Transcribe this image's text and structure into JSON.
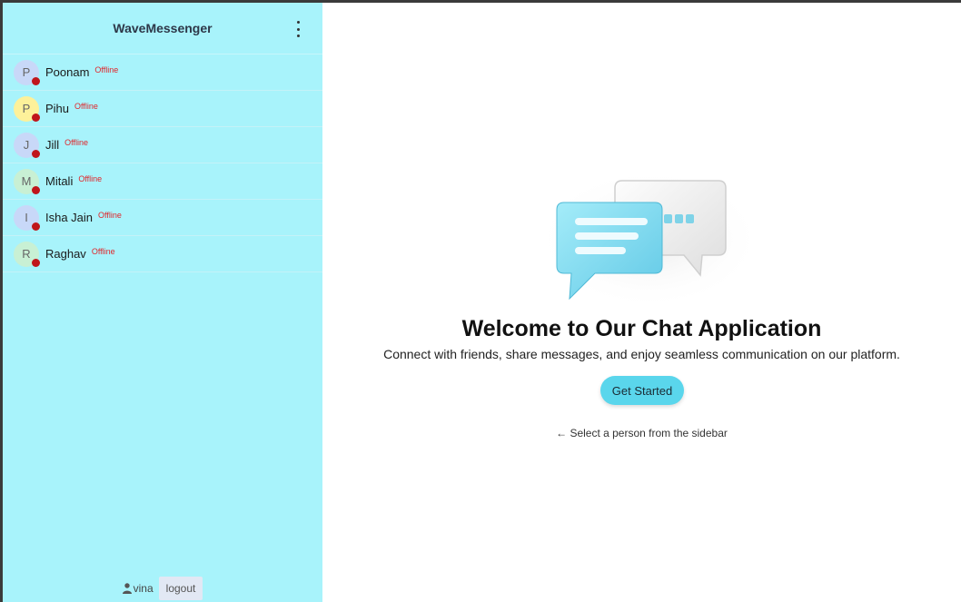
{
  "sidebar": {
    "title": "WaveMessenger",
    "contacts": [
      {
        "initial": "P",
        "name": "Poonam",
        "status": "Offline",
        "avatar_color": "#c8d8f8"
      },
      {
        "initial": "P",
        "name": "Pihu",
        "status": "Offline",
        "avatar_color": "#fdf19a"
      },
      {
        "initial": "J",
        "name": "Jill",
        "status": "Offline",
        "avatar_color": "#c8d8f8"
      },
      {
        "initial": "M",
        "name": "Mitali",
        "status": "Offline",
        "avatar_color": "#c8f0d4"
      },
      {
        "initial": "I",
        "name": "Isha Jain",
        "status": "Offline",
        "avatar_color": "#c8d8f8"
      },
      {
        "initial": "R",
        "name": "Raghav",
        "status": "Offline",
        "avatar_color": "#c8f0d4"
      }
    ],
    "footer": {
      "username": "vina",
      "logout_label": "logout"
    }
  },
  "main": {
    "title": "Welcome to Our Chat Application",
    "subtitle": "Connect with friends, share messages, and enjoy seamless communication on our platform.",
    "cta_label": "Get Started",
    "hint": "← Select a person from the sidebar"
  },
  "icons": {
    "menu": "kebab-menu-icon",
    "user": "user-icon",
    "illustration": "chat-bubbles-icon"
  },
  "colors": {
    "sidebar_bg": "#a8f3fb",
    "offline": "#c0151b",
    "cta": "#5ad6ec"
  }
}
